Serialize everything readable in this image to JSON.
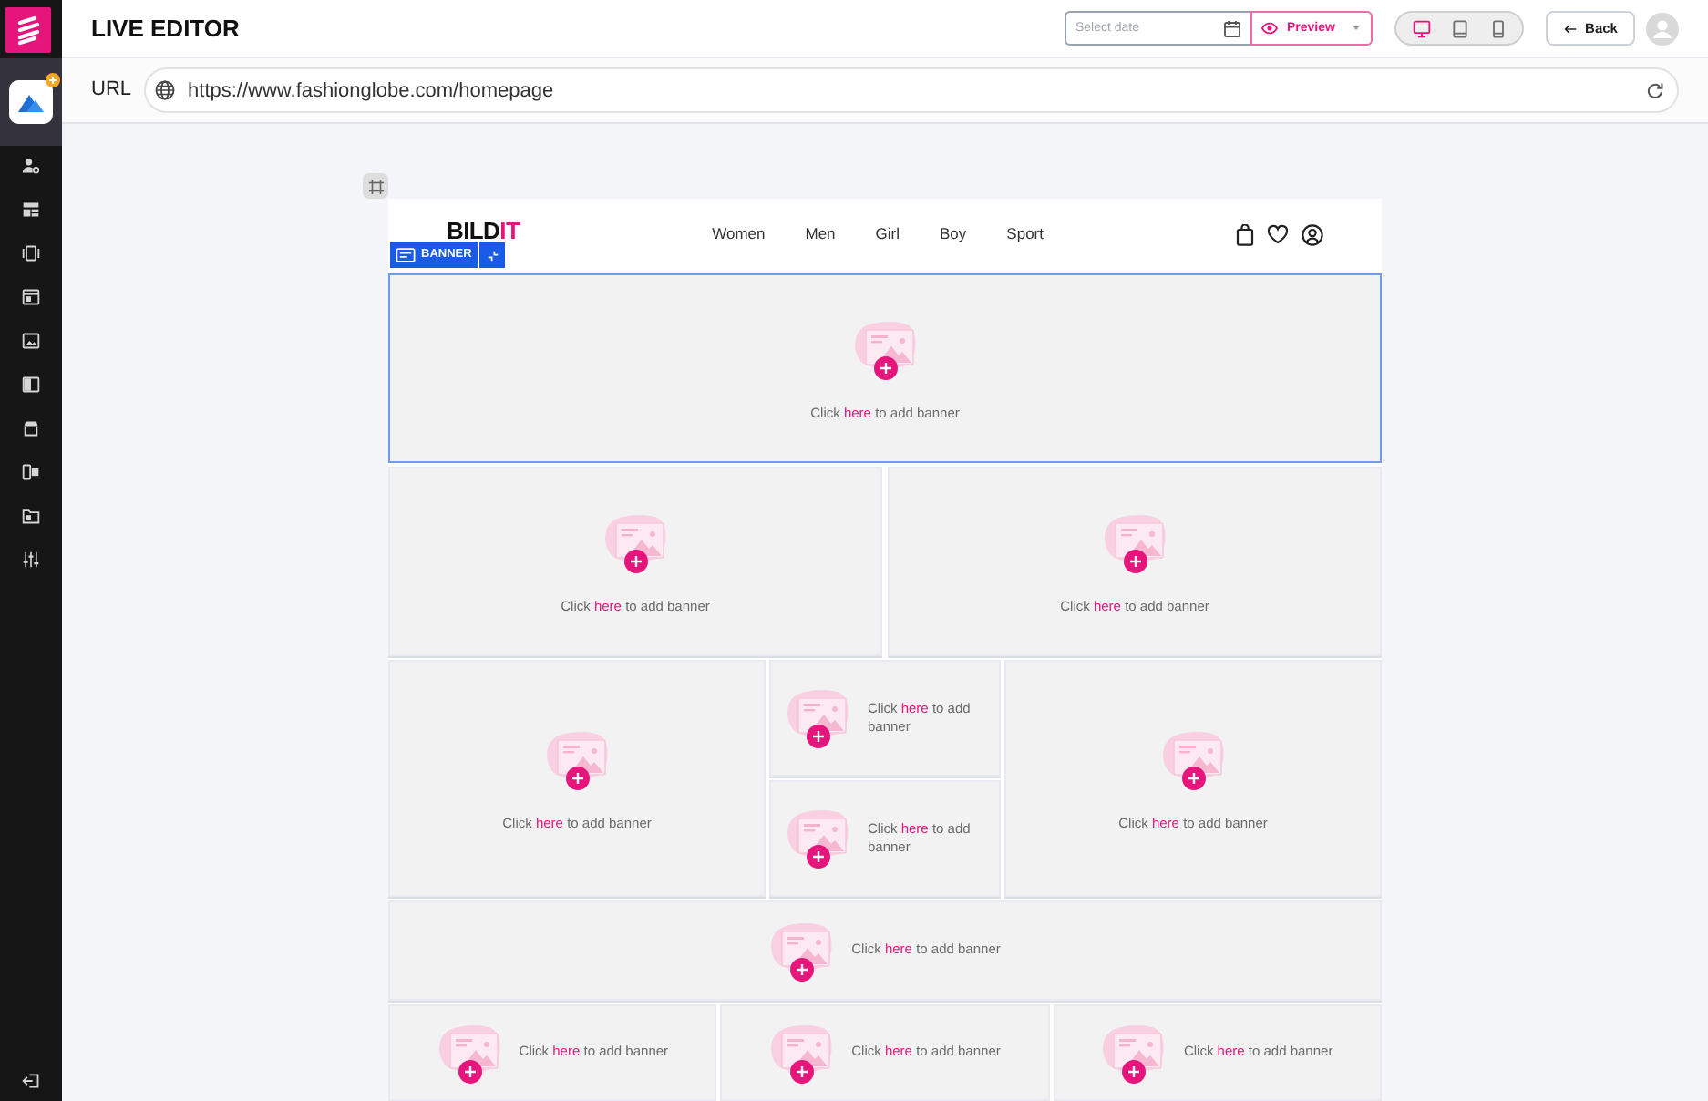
{
  "top_bar": {
    "title": "LIVE EDITOR",
    "date_field": {
      "placeholder": "Select date"
    },
    "preview_button": {
      "label": "Preview"
    },
    "devices": [
      {
        "kind": "desktop",
        "selected": true
      },
      {
        "kind": "tablet",
        "selected": false
      },
      {
        "kind": "mobile",
        "selected": false
      }
    ],
    "back_button": {
      "label": "Back"
    }
  },
  "url_bar": {
    "label": "URL",
    "value": "https://www.fashionglobe.com/homepage"
  },
  "site_header": {
    "logo": {
      "text": "BILD",
      "accent": "IT"
    },
    "nav": [
      "Women",
      "Men",
      "Girl",
      "Boy",
      "Sport"
    ]
  },
  "section_tag": {
    "label": "BANNER"
  },
  "rows": [
    {
      "kind": "hero",
      "columns": [
        {
          "blocks": [
            {
              "kind": "stacked",
              "selected": true,
              "prompt": {
                "before": "Click ",
                "link": "here",
                "after": " to add banner"
              }
            }
          ]
        }
      ]
    },
    {
      "kind": "halves",
      "columns": [
        {
          "blocks": [
            {
              "kind": "stacked",
              "selected": false,
              "prompt": {
                "before": "Click ",
                "link": "here",
                "after": " to add banner"
              }
            }
          ]
        },
        {
          "blocks": [
            {
              "kind": "stacked",
              "selected": false,
              "prompt": {
                "before": "Click ",
                "link": "here",
                "after": " to add banner"
              }
            }
          ]
        }
      ]
    },
    {
      "kind": "side_stack",
      "columns": [
        {
          "blocks": [
            {
              "kind": "stacked",
              "selected": false,
              "prompt": {
                "before": "Click ",
                "link": "here",
                "after": " to add banner"
              }
            }
          ]
        },
        {
          "blocks": [
            {
              "kind": "inline",
              "selected": false,
              "prompt": {
                "before": "Click ",
                "link": "here",
                "after": " to add banner"
              }
            },
            {
              "kind": "inline",
              "selected": false,
              "prompt": {
                "before": "Click ",
                "link": "here",
                "after": " to add banner"
              }
            }
          ]
        },
        {
          "blocks": [
            {
              "kind": "stacked",
              "selected": false,
              "prompt": {
                "before": "Click ",
                "link": "here",
                "after": " to add banner"
              }
            }
          ]
        }
      ]
    },
    {
      "kind": "strip",
      "columns": [
        {
          "blocks": [
            {
              "kind": "inline",
              "selected": false,
              "prompt": {
                "before": "Click ",
                "link": "here",
                "after": " to add banner"
              }
            }
          ]
        }
      ]
    },
    {
      "kind": "thirds",
      "columns": [
        {
          "blocks": [
            {
              "kind": "inline",
              "selected": false,
              "prompt": {
                "before": "Click ",
                "link": "here",
                "after": " to add banner"
              }
            }
          ]
        },
        {
          "blocks": [
            {
              "kind": "inline",
              "selected": false,
              "prompt": {
                "before": "Click ",
                "link": "here",
                "after": " to add banner"
              }
            }
          ]
        },
        {
          "blocks": [
            {
              "kind": "inline",
              "selected": false,
              "prompt": {
                "before": "Click ",
                "link": "here",
                "after": " to add banner"
              }
            }
          ]
        }
      ]
    }
  ]
}
